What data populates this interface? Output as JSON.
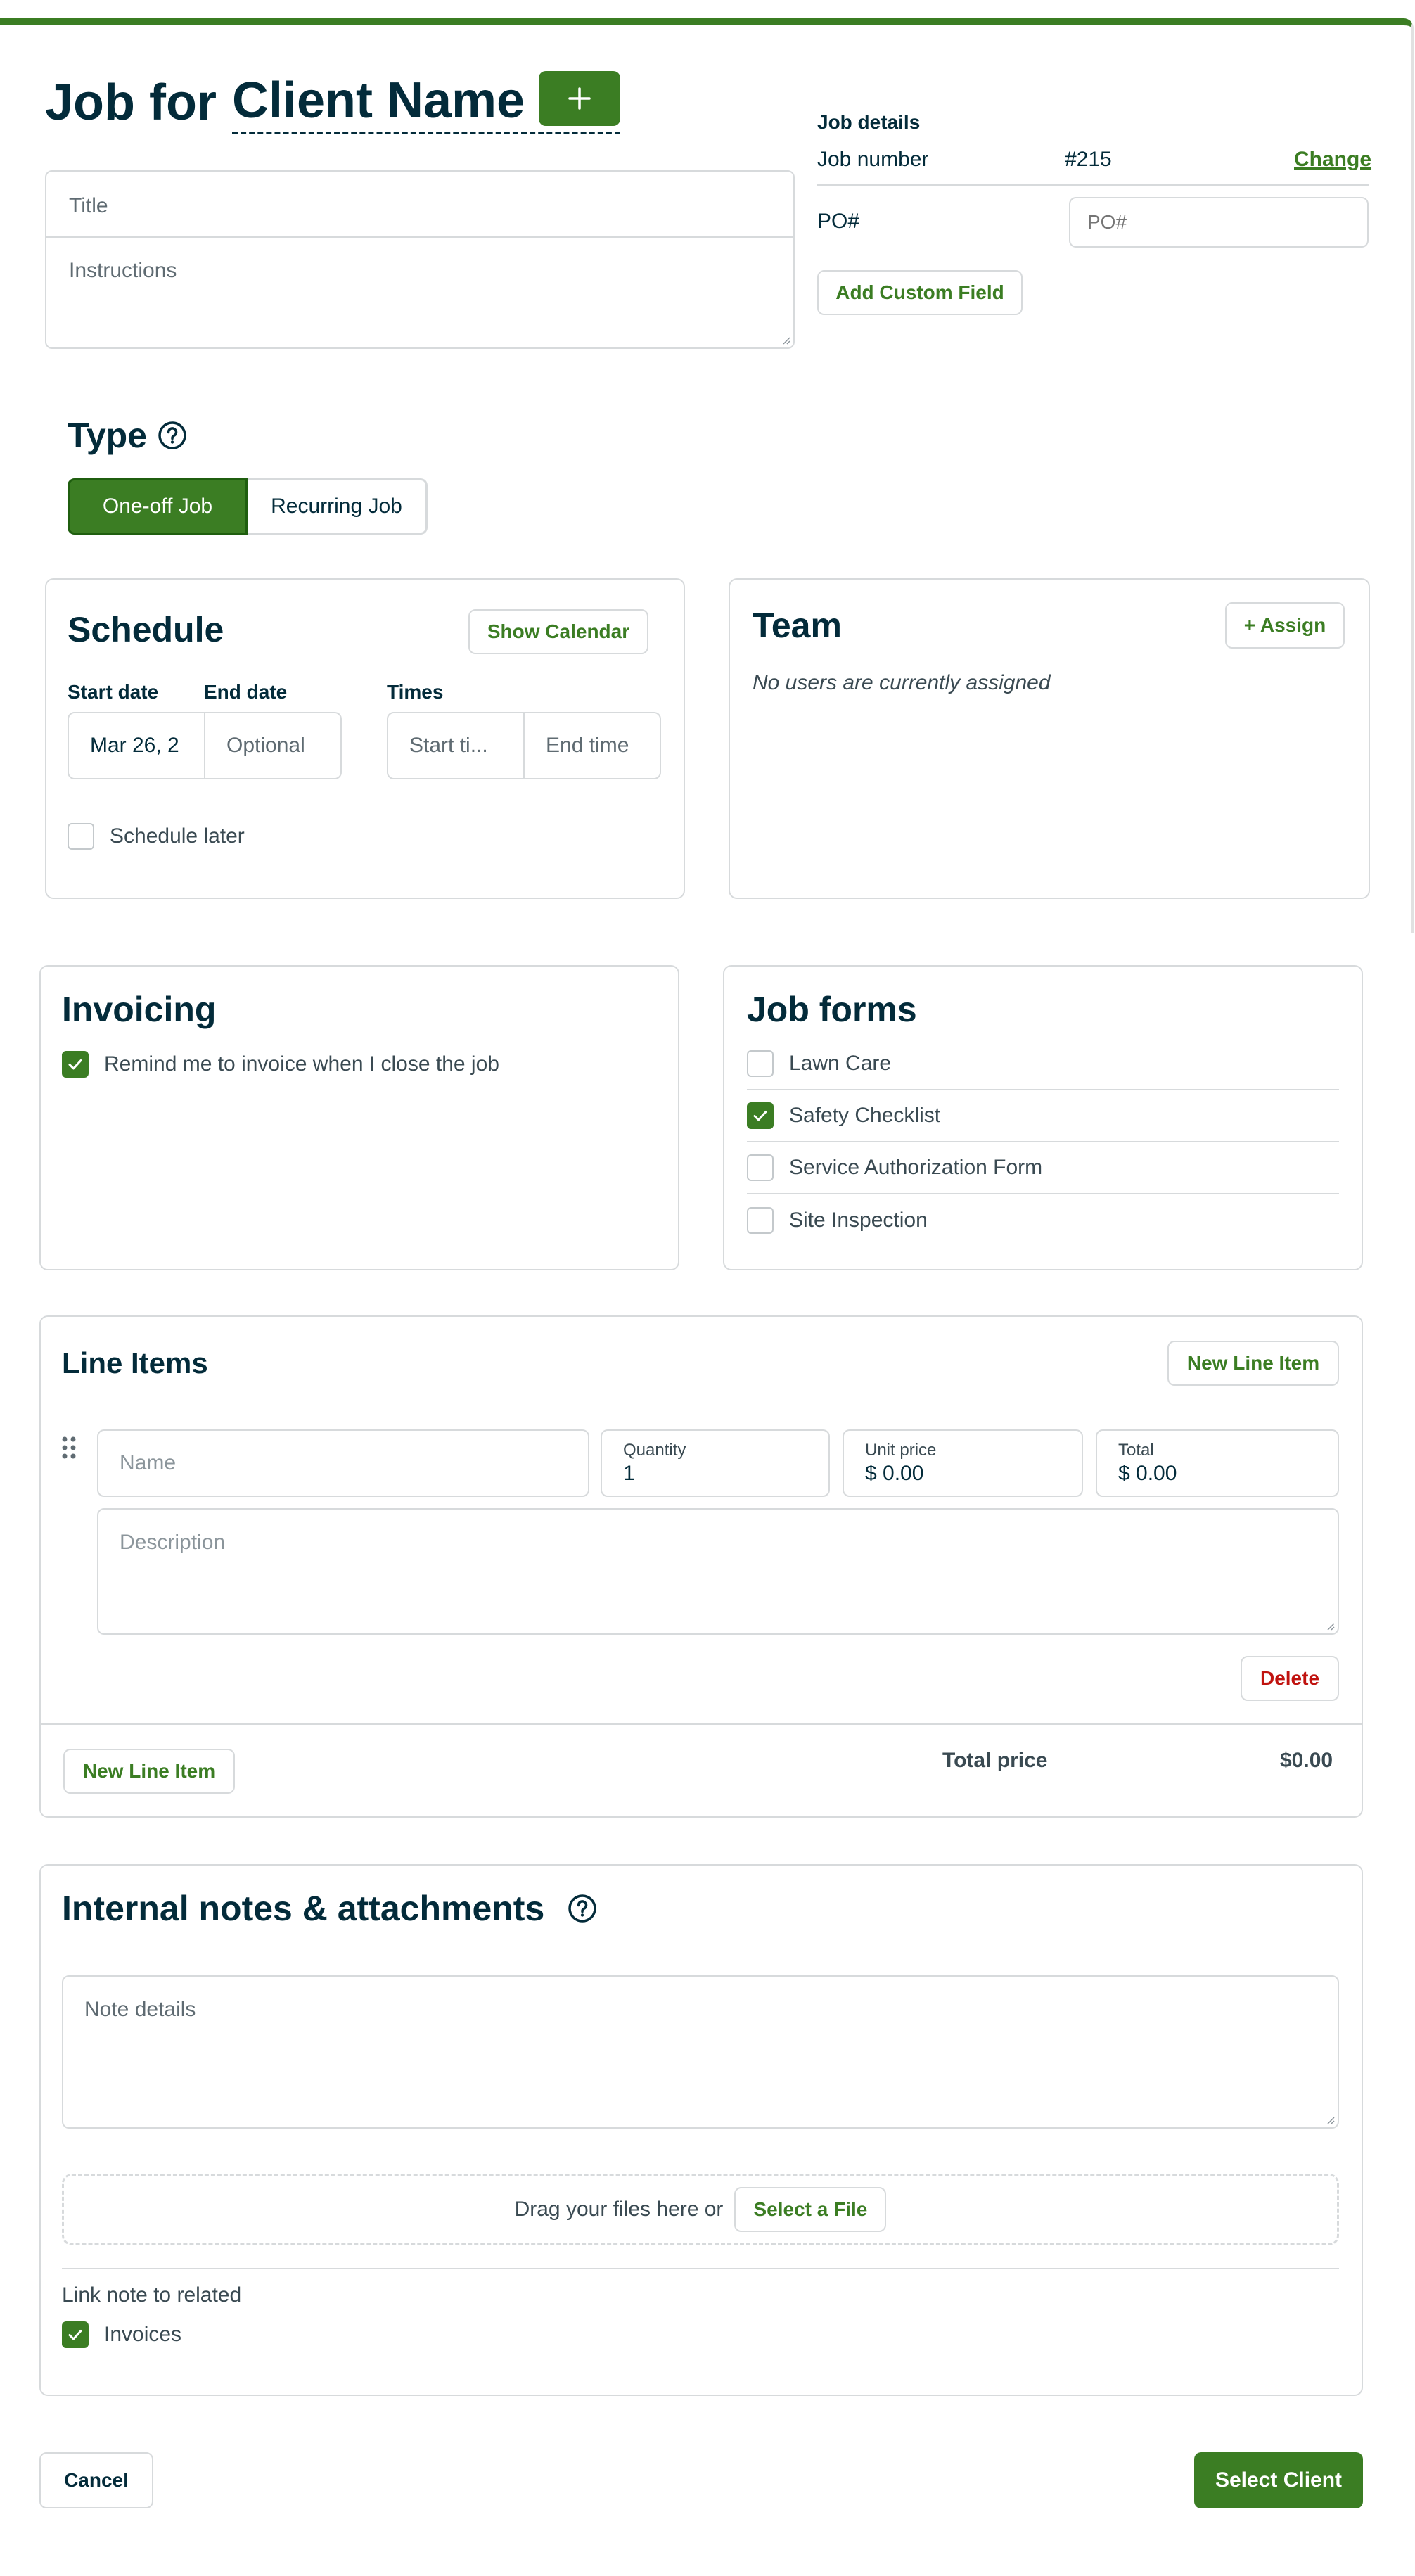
{
  "header": {
    "title_prefix": "Job for",
    "client_name": "Client Name"
  },
  "form": {
    "title_placeholder": "Title",
    "instructions_placeholder": "Instructions"
  },
  "job_details": {
    "heading": "Job details",
    "job_number_label": "Job number",
    "job_number_value": "#215",
    "change_label": "Change",
    "po_label": "PO#",
    "po_placeholder": "PO#",
    "add_custom_field_label": "Add Custom Field"
  },
  "type": {
    "heading": "Type",
    "options": [
      "One-off Job",
      "Recurring Job"
    ],
    "selected": "One-off Job"
  },
  "schedule": {
    "heading": "Schedule",
    "show_calendar_label": "Show Calendar",
    "start_date_label": "Start date",
    "end_date_label": "End date",
    "times_label": "Times",
    "start_date_value": "Mar 26, 2",
    "end_date_placeholder": "Optional",
    "start_time_placeholder": "Start ti...",
    "end_time_placeholder": "End time",
    "schedule_later_label": "Schedule later",
    "schedule_later_checked": false
  },
  "team": {
    "heading": "Team",
    "assign_label": "+ Assign",
    "empty_message": "No users are currently assigned"
  },
  "invoicing": {
    "heading": "Invoicing",
    "remind_label": "Remind me to invoice when I close the job",
    "remind_checked": true
  },
  "job_forms": {
    "heading": "Job forms",
    "items": [
      {
        "label": "Lawn Care",
        "checked": false
      },
      {
        "label": "Safety Checklist",
        "checked": true
      },
      {
        "label": "Service Authorization Form",
        "checked": false
      },
      {
        "label": "Site Inspection",
        "checked": false
      }
    ]
  },
  "line_items": {
    "heading": "Line Items",
    "new_line_item_label": "New Line Item",
    "name_placeholder": "Name",
    "quantity_label": "Quantity",
    "quantity_value": "1",
    "unit_price_label": "Unit price",
    "unit_price_value": "$ 0.00",
    "total_label": "Total",
    "total_value": "$ 0.00",
    "description_placeholder": "Description",
    "delete_label": "Delete",
    "total_price_label": "Total price",
    "total_price_value": "$0.00"
  },
  "notes": {
    "heading": "Internal notes & attachments",
    "note_placeholder": "Note details",
    "drop_text": "Drag your files here or",
    "select_file_label": "Select a File",
    "link_label": "Link note to related",
    "invoices_label": "Invoices",
    "invoices_checked": true
  },
  "footer": {
    "cancel_label": "Cancel",
    "select_client_label": "Select Client"
  },
  "colors": {
    "brand_green": "#3b7d23",
    "text_dark": "#032b3a",
    "border": "#d7dadc",
    "danger": "#c0130f"
  }
}
